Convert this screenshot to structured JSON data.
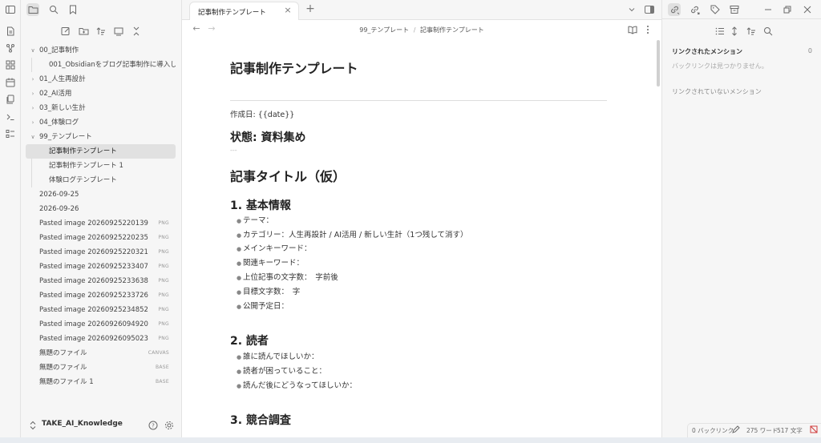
{
  "sidebar": {
    "icons": [
      "files-icon",
      "search-icon",
      "bookmark-icon"
    ],
    "tools": [
      "new-note-icon",
      "new-folder-icon",
      "sort-icon",
      "collapse-view-icon",
      "collapse-all-icon"
    ],
    "tree": [
      {
        "label": "00_記事制作",
        "chev": "∨",
        "depth": 0
      },
      {
        "label": "001_Obsidianをブログ記事制作に導入し...",
        "depth": 1
      },
      {
        "label": "01_人生再設計",
        "chev": "›",
        "depth": 0
      },
      {
        "label": "02_AI活用",
        "chev": "›",
        "depth": 0
      },
      {
        "label": "03_新しい生計",
        "chev": "›",
        "depth": 0
      },
      {
        "label": "04_体験ログ",
        "chev": "›",
        "depth": 0
      },
      {
        "label": "99_テンプレート",
        "chev": "∨",
        "depth": 0
      },
      {
        "label": "記事制作テンプレート",
        "depth": 1,
        "selected": true
      },
      {
        "label": "記事制作テンプレート 1",
        "depth": 1
      },
      {
        "label": "体験ログテンプレート",
        "depth": 1
      },
      {
        "label": "2026-09-25",
        "depth": 0
      },
      {
        "label": "2026-09-26",
        "depth": 0
      },
      {
        "label": "Pasted image 20260925220139",
        "tag": "PNG",
        "depth": 0
      },
      {
        "label": "Pasted image 20260925220235",
        "tag": "PNG",
        "depth": 0
      },
      {
        "label": "Pasted image 20260925220321",
        "tag": "PNG",
        "depth": 0
      },
      {
        "label": "Pasted image 20260925233407",
        "tag": "PNG",
        "depth": 0
      },
      {
        "label": "Pasted image 20260925233638",
        "tag": "PNG",
        "depth": 0
      },
      {
        "label": "Pasted image 20260925233726",
        "tag": "PNG",
        "depth": 0
      },
      {
        "label": "Pasted image 20260925234852",
        "tag": "PNG",
        "depth": 0
      },
      {
        "label": "Pasted image 20260926094920",
        "tag": "PNG",
        "depth": 0
      },
      {
        "label": "Pasted image 20260926095023",
        "tag": "PNG",
        "depth": 0
      },
      {
        "label": "無題のファイル",
        "tag": "CANVAS",
        "depth": 0
      },
      {
        "label": "無題のファイル",
        "tag": "BASE",
        "depth": 0
      },
      {
        "label": "無題のファイル 1",
        "tag": "BASE",
        "depth": 0
      }
    ],
    "vault_name": "TAKE_AI_Knowledge"
  },
  "tab": {
    "title": "記事制作テンプレート",
    "close": "×",
    "new": "+"
  },
  "breadcrumb": {
    "folder": "99_テンプレート",
    "sep": "/",
    "file": "記事制作テンプレート"
  },
  "doc": {
    "title": "記事制作テンプレート",
    "created": "作成日: {{date}}",
    "status": "状態: 資料集め",
    "dash": "---",
    "article_title": "記事タイトル（仮）",
    "s1": "1. 基本情報",
    "s1_items": [
      "テーマ：",
      "カテゴリー：人生再設計 / AI活用 / 新しい生計（1つ残して消す）",
      "メインキーワード：",
      "関連キーワード：",
      "上位記事の文字数：　字前後",
      "目標文字数：　字",
      "公開予定日："
    ],
    "s2": "2. 読者",
    "s2_items": [
      "誰に読んでほしいか：",
      "読者が困っていること：",
      "読んだ後にどうなってほしいか："
    ],
    "s3": "3. 競合調査"
  },
  "backlinks": {
    "heading": "リンクされたメンション",
    "count": "0",
    "empty": "バックリンクは見つかりません。",
    "unlinked": "リンクされていないメンション"
  },
  "status": {
    "backlinks": "0 バックリンク",
    "words": "275 ワード",
    "chars": "517 文字"
  }
}
